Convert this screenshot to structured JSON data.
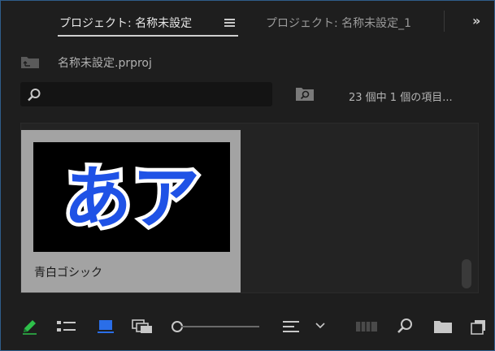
{
  "tabs": [
    {
      "label": "プロジェクト: 名称未設定",
      "active": true
    },
    {
      "label": "プロジェクト: 名称未設定_1",
      "active": false
    }
  ],
  "project": {
    "file_name": "名称未設定.prproj"
  },
  "search": {
    "placeholder": "",
    "value": ""
  },
  "item_count": "23 個中 1 個の項目...",
  "clips": [
    {
      "name": "青白ゴシック",
      "thumbnail_text": "あア"
    }
  ],
  "colors": {
    "accent_blue": "#2a6ee8",
    "pen_green": "#2ec04a",
    "thumb_glyph_fill": "#1f52e6",
    "thumb_glyph_outline": "#ffffff"
  },
  "icons": {
    "menu": "hamburger-icon",
    "overflow": "double-chevron-icon",
    "project_folder": "project-folder-icon",
    "search": "search-icon",
    "bin_search": "find-bin-icon",
    "pen": "pencil-icon",
    "list_view": "list-view-icon",
    "icon_view": "icon-view-icon",
    "freeform_view": "freeform-view-icon",
    "zoom": "zoom-slider",
    "sort": "sort-icon",
    "sort_dropdown": "chevron-down-icon",
    "automate": "automate-sequence-icon",
    "find": "find-icon",
    "new_bin": "new-bin-icon",
    "new_item": "new-item-icon"
  }
}
